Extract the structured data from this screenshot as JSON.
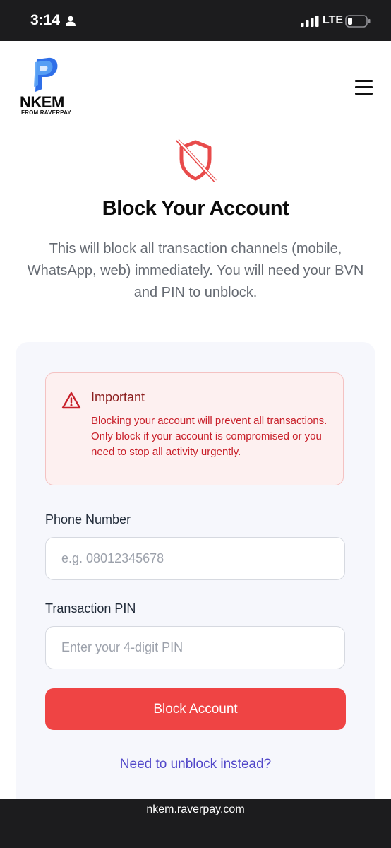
{
  "status_bar": {
    "time": "3:14",
    "network": "LTE"
  },
  "brand": {
    "name": "NKEM",
    "sub": "FROM RAVERPAY"
  },
  "page": {
    "title": "Block Your Account",
    "subtitle": "This will block all transaction channels (mobile, WhatsApp, web) immediately. You will need your BVN and PIN to unblock."
  },
  "warning": {
    "title": "Important",
    "text": "Blocking your account will prevent all transactions. Only block if your account is compromised or you need to stop all activity urgently."
  },
  "form": {
    "phone_label": "Phone Number",
    "phone_placeholder": "e.g. 08012345678",
    "pin_label": "Transaction PIN",
    "pin_placeholder": "Enter your 4-digit PIN",
    "submit_label": "Block Account",
    "unblock_link": "Need to unblock instead?"
  },
  "browser": {
    "url": "nkem.raverpay.com"
  },
  "colors": {
    "danger": "#ef4444",
    "link": "#5147c9",
    "brand_blue": "#2f6fe8"
  },
  "icons": [
    "person-icon",
    "signal-icon",
    "battery-icon",
    "menu-icon",
    "shield-off-icon",
    "warning-triangle-icon"
  ]
}
